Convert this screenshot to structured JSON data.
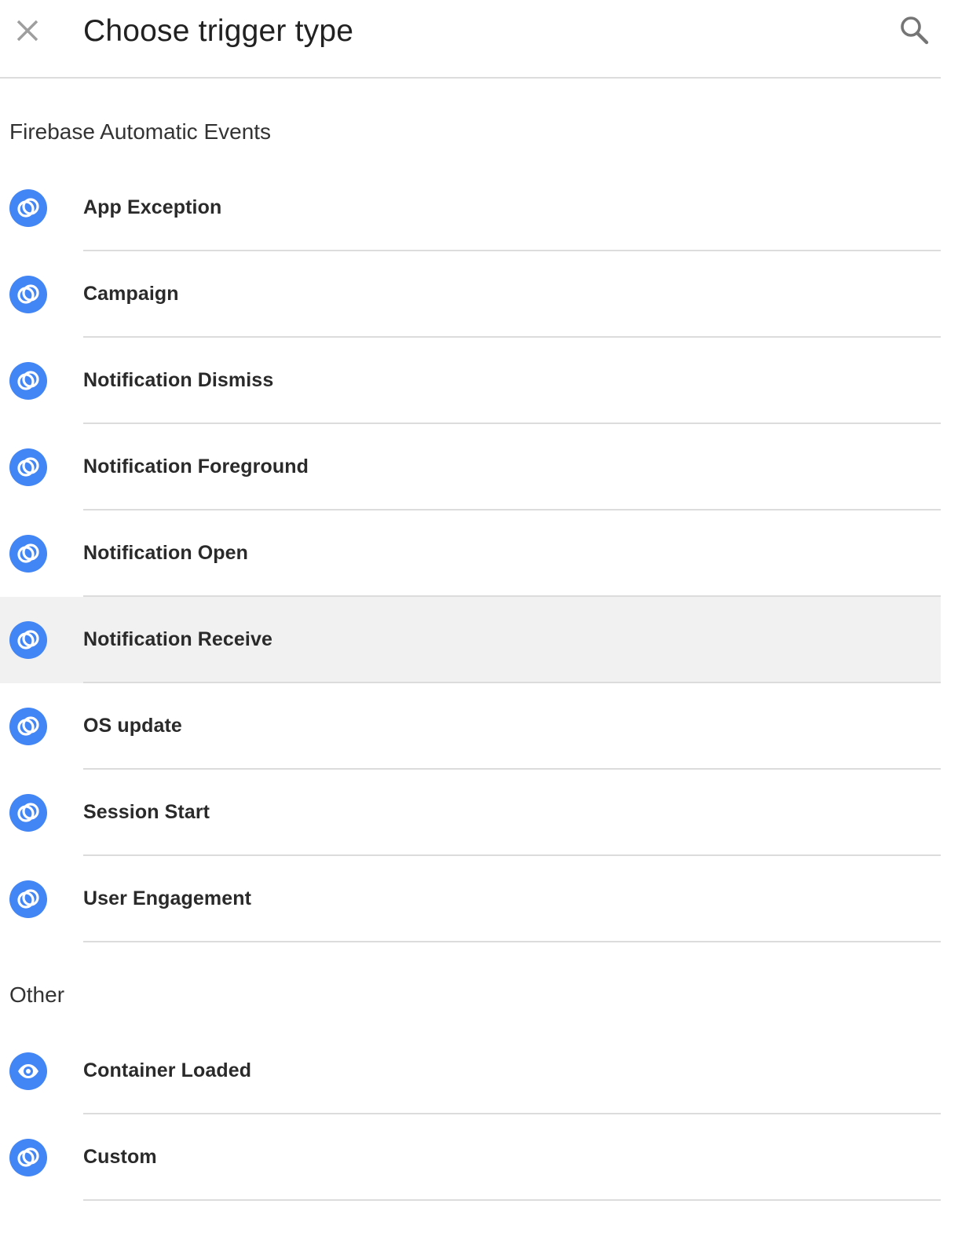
{
  "header": {
    "close_icon": "close-icon",
    "title": "Choose trigger type",
    "search_icon": "search-icon"
  },
  "colors": {
    "accent_blue": "#4285f4",
    "divider": "#dcdcdc",
    "highlight_row": "#f1f1f1",
    "text": "#212121",
    "icon_gray": "#9e9e9e"
  },
  "sections": [
    {
      "title": "Firebase Automatic Events",
      "items": [
        {
          "label": "App Exception",
          "icon": "firebase-event-icon",
          "highlighted": false
        },
        {
          "label": "Campaign",
          "icon": "firebase-event-icon",
          "highlighted": false
        },
        {
          "label": "Notification Dismiss",
          "icon": "firebase-event-icon",
          "highlighted": false
        },
        {
          "label": "Notification Foreground",
          "icon": "firebase-event-icon",
          "highlighted": false
        },
        {
          "label": "Notification Open",
          "icon": "firebase-event-icon",
          "highlighted": false
        },
        {
          "label": "Notification Receive",
          "icon": "firebase-event-icon",
          "highlighted": true
        },
        {
          "label": "OS update",
          "icon": "firebase-event-icon",
          "highlighted": false
        },
        {
          "label": "Session Start",
          "icon": "firebase-event-icon",
          "highlighted": false
        },
        {
          "label": "User Engagement",
          "icon": "firebase-event-icon",
          "highlighted": false
        }
      ]
    },
    {
      "title": "Other",
      "items": [
        {
          "label": "Container Loaded",
          "icon": "eye-icon",
          "highlighted": false
        },
        {
          "label": "Custom",
          "icon": "firebase-event-icon",
          "highlighted": false
        }
      ]
    }
  ]
}
